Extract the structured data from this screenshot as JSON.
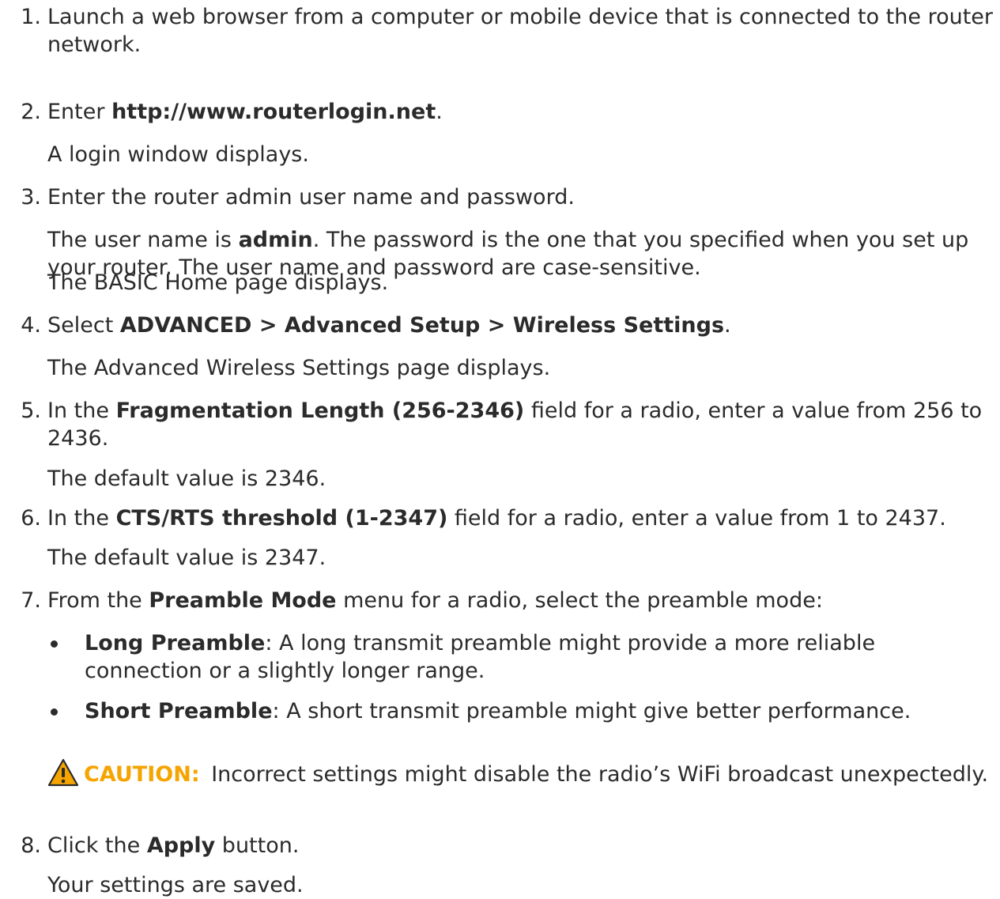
{
  "steps": [
    {
      "num": "1.",
      "text": "Launch a web browser from a computer or mobile device that is connected to the router network."
    },
    {
      "num": "2.",
      "pre": "Enter ",
      "bold": "http://www.routerlogin.net",
      "post": ".",
      "sub": "A login window displays."
    },
    {
      "num": "3.",
      "text": "Enter the router admin user name and password.",
      "sub1_pre": "The user name is ",
      "sub1_bold": "admin",
      "sub1_post": ". The password is the one that you specified when you set up your router. The user name and password are case-sensitive.",
      "sub2": "The BASIC Home page displays."
    },
    {
      "num": "4.",
      "pre": "Select ",
      "bold": "ADVANCED > Advanced Setup > Wireless Settings",
      "post": ".",
      "sub": "The Advanced Wireless Settings page displays."
    },
    {
      "num": "5.",
      "pre": "In the ",
      "bold": "Fragmentation Length (256-2346)",
      "post": " field for a radio, enter a value from 256 to 2436.",
      "sub": "The default value is 2346."
    },
    {
      "num": "6.",
      "pre": "In the ",
      "bold": "CTS/RTS threshold (1-2347)",
      "post": " field for a radio, enter a value from 1 to 2437.",
      "sub": "The default value is 2347."
    },
    {
      "num": "7.",
      "pre": "From the ",
      "bold": "Preamble Mode",
      "post": " menu for a radio, select the preamble mode:"
    },
    {
      "num": "8.",
      "pre": "Click the ",
      "bold": "Apply",
      "post": " button.",
      "sub": "Your settings are saved."
    }
  ],
  "bullets": [
    {
      "bold": "Long Preamble",
      "text": ": A long transmit preamble might provide a more reliable connection or a slightly longer range."
    },
    {
      "bold": "Short Preamble",
      "text": ": A short transmit preamble might give better performance."
    }
  ],
  "caution": {
    "label": "CAUTION:",
    "text": " Incorrect settings might disable the radio’s WiFi broadcast unexpectedly.",
    "icon": "warning-triangle-icon",
    "label_color": "#f5a400"
  }
}
